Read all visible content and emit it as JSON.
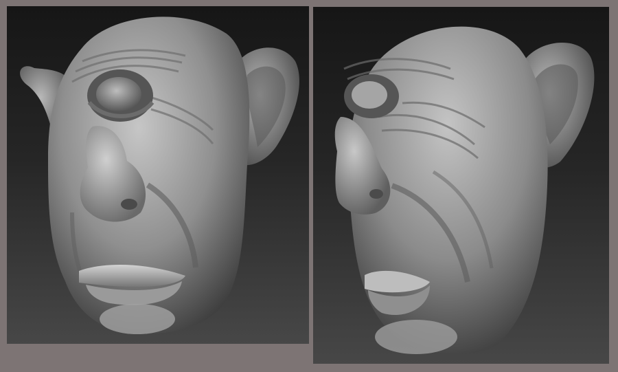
{
  "image": {
    "description_free": true,
    "panels": [
      {
        "id": "left",
        "view": "front-three-quarter",
        "subject": "sculpted-head-render"
      },
      {
        "id": "right",
        "view": "side-three-quarter",
        "subject": "sculpted-head-render"
      }
    ],
    "colors": {
      "frame": "#7d7474",
      "background_top": "#161616",
      "background_bottom": "#474747",
      "clay_light": "#b9b9b9",
      "clay_mid": "#8a8a8a",
      "clay_dark": "#3c3c3c"
    }
  }
}
